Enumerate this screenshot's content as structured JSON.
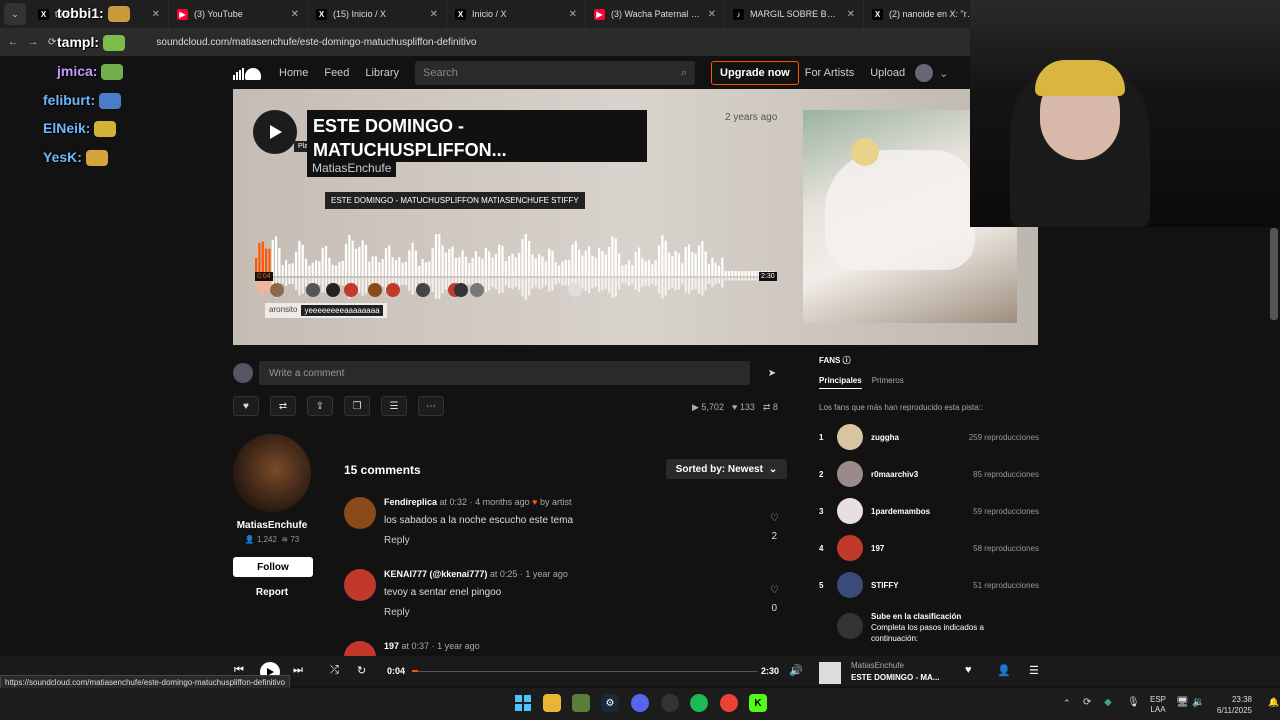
{
  "browser": {
    "tabs": [
      {
        "label": "tobbi1:",
        "icon": "x-logo-icon",
        "color": "#000000"
      },
      {
        "label": "(3) YouTube",
        "icon": "youtube-icon",
        "color": "#ff0033"
      },
      {
        "label": "(15) Inicio / X",
        "icon": "x-logo-icon",
        "color": "#000000"
      },
      {
        "label": "Inicio / X",
        "icon": "x-logo-icon",
        "color": "#000000"
      },
      {
        "label": "(3) Wacha Paternal - YouT",
        "icon": "youtube-icon",
        "color": "#ff0033"
      },
      {
        "label": "MARGIL SOBRE BAULO Y",
        "icon": "tiktok-icon",
        "color": "#000000"
      },
      {
        "label": "(2) nanoide en X: \"recien",
        "icon": "x-logo-icon",
        "color": "#000000"
      }
    ],
    "url": "soundcloud.com/matiasenchufe/este-domingo-matuchuspliffon-definitivo",
    "status_url": "https://soundcloud.com/matiasenchufe/este-domingo-matuchuspliffon-definitivo"
  },
  "chat": [
    {
      "user": "tobbi1:",
      "color": "#ffffff"
    },
    {
      "user": "tampl:",
      "color": "#ffffff"
    },
    {
      "user": "jmica:",
      "color": "#c49cff"
    },
    {
      "user": "feliburt:",
      "color": "#6fb8ff"
    },
    {
      "user": "ElNeik:",
      "color": "#6fb8ff"
    },
    {
      "user": "YesK:",
      "color": "#6fb8ff"
    }
  ],
  "header": {
    "nav": [
      "Home",
      "Feed",
      "Library"
    ],
    "search_placeholder": "Search",
    "upgrade": "Upgrade now",
    "for_artists": "For Artists",
    "upload": "Upload"
  },
  "track": {
    "title": "ESTE DOMINGO - MATUCHUSPLIFFON...",
    "artist": "MatiasEnchufe",
    "posted": "2 years ago",
    "play_tooltip": "Play",
    "tooltip": "ESTE DOMINGO - MATUCHUSPLIFFON MATIASENCHUFE STIFFY",
    "current_time": "0:04",
    "duration": "2:30",
    "progress": 0.027,
    "hover_user": "aronsito",
    "hover_text": "yeeeeeeeeaaaaaaaa"
  },
  "comment_input": {
    "placeholder": "Write a comment"
  },
  "stats": {
    "plays": "5,702",
    "likes": "133",
    "reposts": "8"
  },
  "uploader": {
    "name": "MatiasEnchufe",
    "followers": "1,242",
    "tracks": "73",
    "follow": "Follow",
    "report": "Report"
  },
  "comments_section": {
    "count": "15 comments",
    "sort": "Sorted by: Newest",
    "items": [
      {
        "user": "Fendireplica",
        "at": "0:32",
        "ago": "4 months ago",
        "by_artist": "by artist",
        "text": "los sabados a la noche escucho este tema",
        "reply": "Reply",
        "likes": "2",
        "color": "#8a4a1a"
      },
      {
        "user": "KENAI777 (@kkenai777)",
        "at": "0:25",
        "ago": "1 year ago",
        "by_artist": "",
        "text": "tevoy a sentar enel pingoo",
        "reply": "Reply",
        "likes": "0",
        "color": "#c0392b"
      },
      {
        "user": "197",
        "at": "0:37",
        "ago": "1 year ago",
        "by_artist": "",
        "text": "",
        "reply": "",
        "likes": "",
        "color": "#c0392b"
      }
    ]
  },
  "fans": {
    "title": "FANS",
    "tabs": [
      "Principales",
      "Primeros"
    ],
    "desc": "Los fans que más han reproducido esta pista::",
    "items": [
      {
        "rank": "1",
        "name": "zuggha",
        "plays": "259 reproducciones",
        "color": "#d9c4a0"
      },
      {
        "rank": "2",
        "name": "r0maarchiv3",
        "plays": "85 reproducciones",
        "color": "#9a8a8a"
      },
      {
        "rank": "3",
        "name": "1pardemambos",
        "plays": "59 reproducciones",
        "color": "#e8e0e0"
      },
      {
        "rank": "4",
        "name": "197",
        "plays": "58 reproducciones",
        "color": "#c0392b"
      },
      {
        "rank": "5",
        "name": "STIFFY",
        "plays": "51 reproducciones",
        "color": "#3a4a7a"
      }
    ],
    "climb_title": "Sube en la clasificación",
    "climb_text1": "Completa los pasos indicados a",
    "climb_text2": "continuación:"
  },
  "player": {
    "time": "0:04",
    "duration": "2:30",
    "artist": "MatiasEnchufe",
    "title": "ESTE DOMINGO - MA..."
  },
  "taskbar": {
    "lang1": "ESP",
    "lang2": "LAA",
    "time": "23:38",
    "date": "6/11/2025"
  }
}
